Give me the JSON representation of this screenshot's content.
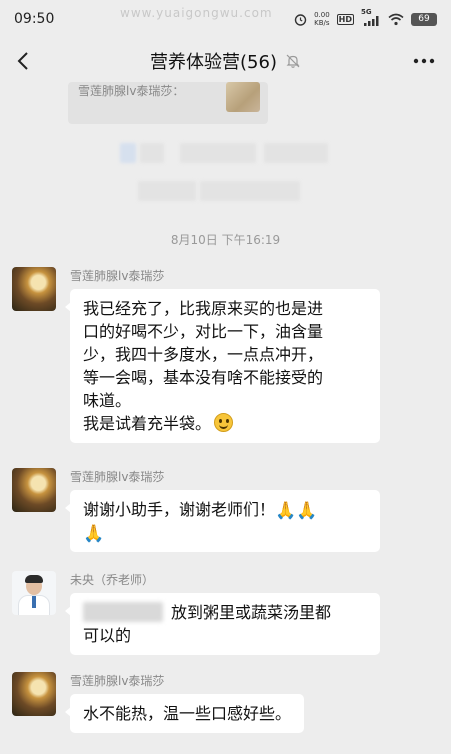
{
  "status_bar": {
    "time": "09:50",
    "watermark": "www.yuaigongwu.com",
    "net_speed_top": "0.00",
    "net_speed_bottom": "KB/s",
    "hd": "HD",
    "signal_label": "5G",
    "battery": "69"
  },
  "header": {
    "title": "营养体验营(56)",
    "icons": [
      "back-icon",
      "mute-bell-icon",
      "more-icon"
    ]
  },
  "quote": {
    "text": "雪莲肺腺lv泰瑞莎："
  },
  "timestamp": "8月10日 下午16:19",
  "messages": [
    {
      "sender": "雪莲肺腺lv泰瑞莎",
      "lines": [
        "我已经充了，比我原来买的也是进",
        "口的好喝不少，对比一下，油含量",
        "少，我四十多度水，一点点冲开，",
        "等一会喝，基本没有啥不能接受的",
        "味道。",
        "我是试着充半袋。"
      ],
      "emoji": "smile-emoji"
    },
    {
      "sender": "雪莲肺腺lv泰瑞莎",
      "line1": "谢谢小助手，谢谢老师们！",
      "emoji_a": "🙏",
      "emoji_b": "🙏",
      "emoji_c": "🙏"
    },
    {
      "sender": "未央（乔老师）",
      "line1": "放到粥里或蔬菜汤里都",
      "line2": "可以的"
    },
    {
      "sender": "雪莲肺腺lv泰瑞莎",
      "line1": "水不能热，温一些口感好些。"
    }
  ],
  "colors": {
    "background": "#ededed",
    "bubble": "#ffffff",
    "meta_text": "#999999"
  }
}
